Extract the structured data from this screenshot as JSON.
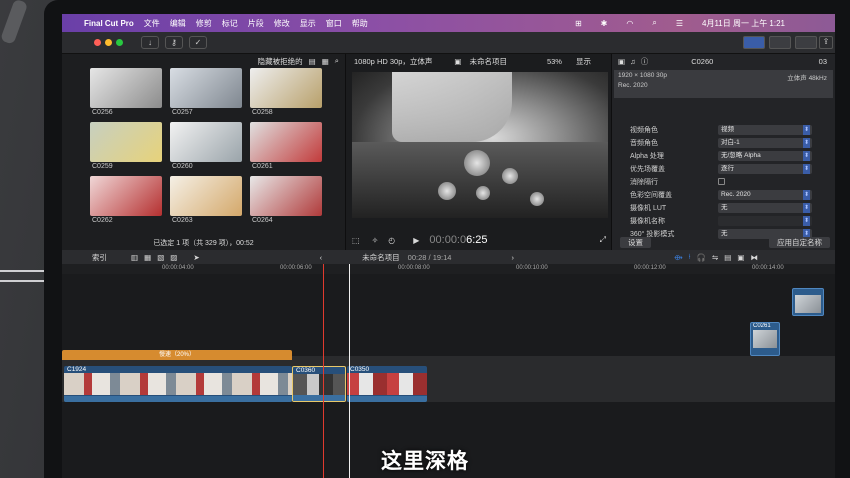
{
  "menubar": {
    "app_name": "Final Cut Pro",
    "items": [
      "文件",
      "编辑",
      "修剪",
      "标记",
      "片段",
      "修改",
      "显示",
      "窗口",
      "帮助"
    ],
    "datetime": "4月11日 周一 上午 1:21"
  },
  "browser": {
    "filter_label": "隐藏被拒绝的",
    "clips": [
      "C0256",
      "C0257",
      "C0258",
      "C0259",
      "C0260",
      "C0261",
      "C0262",
      "C0263",
      "C0264"
    ],
    "selection_status": "已选定 1 项（共 329 项），00:52"
  },
  "viewer": {
    "format": "1080p HD 30p，立体声",
    "project_name": "未命名项目",
    "zoom": "53%",
    "display_label": "显示",
    "timecode_dim": "00:00:0",
    "timecode_bright": "6:25"
  },
  "inspector": {
    "clip_id": "C0260",
    "duration": "03",
    "info_line1": "1920 × 1080 30p",
    "info_line2": "Rec. 2020",
    "info_right": "立体声 48kHz",
    "rows": [
      {
        "label": "视频角色",
        "value": "视频"
      },
      {
        "label": "音频角色",
        "value": "对白-1"
      },
      {
        "label": "Alpha 处理",
        "value": "无/忽略 Alpha"
      },
      {
        "label": "优先场覆盖",
        "value": "逐行"
      },
      {
        "label": "消除隔行",
        "value": ""
      },
      {
        "label": "色彩空间覆盖",
        "value": "Rec. 2020"
      },
      {
        "label": "摄像机 LUT",
        "value": "无"
      },
      {
        "label": "摄像机名称",
        "value": ""
      },
      {
        "label": "360° 投影模式",
        "value": "无"
      }
    ],
    "settings_button": "设置",
    "apply_button": "应用自定名称"
  },
  "timeline": {
    "index_label": "索引",
    "project_name": "未命名项目",
    "position": "00:28 / 19:14",
    "ruler": [
      "00:00:04:00",
      "00:00:06:00",
      "00:00:08:00",
      "00:00:10:00",
      "00:00:12:00",
      "00:00:14:00"
    ],
    "retime_label": "慢速（20%）",
    "clips": [
      "C1924",
      "C0360",
      "C0350"
    ],
    "connected_clip": "C0261"
  },
  "subtitle": "这里深格",
  "colors": {
    "accent": "#3a5da8",
    "playhead_red": "#e03a2e",
    "retime": "#d68b2f",
    "clip_blue": "#274f7a"
  }
}
